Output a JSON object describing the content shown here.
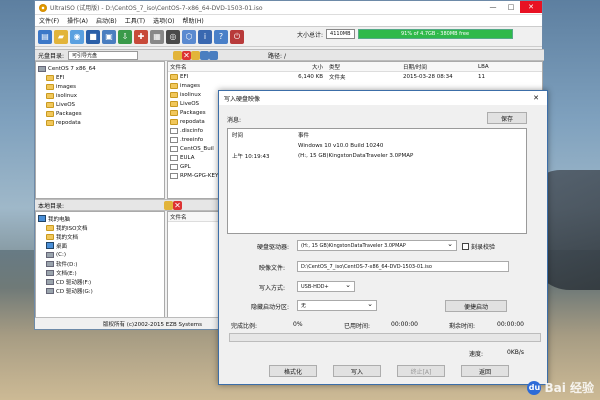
{
  "window": {
    "title": "UltraISO (试用版) - D:\\CentOS_7_iso\\CentOS-7-x86_64-DVD-1503-01.iso",
    "min": "—",
    "max": "□",
    "close": "✕"
  },
  "menu": [
    "文件(F)",
    "操作(A)",
    "启动(B)",
    "工具(T)",
    "选项(O)",
    "帮助(H)"
  ],
  "size": {
    "label": "大小总计:",
    "value": "4110MB",
    "bar": "91% of 4.7GB - 380MB free",
    "fraction": 0.91
  },
  "image_pane": {
    "label": "光盘目录:",
    "combo": "可引导光盘",
    "path_label": "路径: /"
  },
  "tree": [
    "CentOS 7 x86_64",
    "EFI",
    "images",
    "isolinux",
    "LiveOS",
    "Packages",
    "repodata"
  ],
  "files": {
    "headers": [
      "文件名",
      "大小",
      "类型",
      "日期/时间",
      "LBA"
    ],
    "rows": [
      {
        "name": "EFI",
        "size": "6,140 KB",
        "type": "文件夹",
        "date": "2015-03-28 08:34",
        "lba": "11"
      },
      {
        "name": "images",
        "size": "",
        "type": "",
        "date": "",
        "lba": ""
      },
      {
        "name": "isolinux",
        "size": "",
        "type": "",
        "date": "",
        "lba": ""
      },
      {
        "name": "LiveOS",
        "size": "",
        "type": "",
        "date": "",
        "lba": ""
      },
      {
        "name": "Packages",
        "size": "",
        "type": "",
        "date": "",
        "lba": ""
      },
      {
        "name": "repodata",
        "size": "",
        "type": "",
        "date": "",
        "lba": ""
      },
      {
        "name": ".discinfo",
        "size": "",
        "type": "",
        "date": "",
        "lba": ""
      },
      {
        "name": ".treeinfo",
        "size": "",
        "type": "",
        "date": "",
        "lba": ""
      },
      {
        "name": "CentOS_Buil",
        "size": "",
        "type": "",
        "date": "",
        "lba": ""
      },
      {
        "name": "EULA",
        "size": "",
        "type": "",
        "date": "",
        "lba": ""
      },
      {
        "name": "GPL",
        "size": "",
        "type": "",
        "date": "",
        "lba": ""
      },
      {
        "name": "RPM-GPG-KEY",
        "size": "",
        "type": "",
        "date": "",
        "lba": ""
      }
    ]
  },
  "local_pane": {
    "label": "本地目录:"
  },
  "local_tree": [
    "我的电脑",
    "我的ISO文档",
    "我的文档",
    "桌面",
    "(C:)",
    "软件(D:)",
    "文档(E:)",
    "CD 驱动器(F:)",
    "CD 驱动器(G:)"
  ],
  "local_files": {
    "header": "文件名"
  },
  "status": "版权所有 (c)2002-2015 EZB Systems",
  "dialog": {
    "title": "写入硬盘映像",
    "close": "✕",
    "msg_label": "消息:",
    "save": "保存",
    "col_time": "时间",
    "col_event": "事件",
    "rows": [
      {
        "time": "",
        "event": "Windows 10 v10.0 Build 10240"
      },
      {
        "time": "上午 10:19:43",
        "event": "(H:, 15 GB)KingstonDataTraveler 3.0PMAP"
      }
    ],
    "drive_label": "硬盘驱动器:",
    "drive": "(H:, 15 GB)KingstonDataTraveler 3.0PMAP",
    "verify": "刻录校验",
    "image_label": "映像文件:",
    "image": "D:\\CentOS_7_iso\\CentOS-7-x86_64-DVD-1503-01.iso",
    "method_label": "写入方式:",
    "method": "USB-HDD+",
    "hidden_label": "隐藏启动分区:",
    "hidden": "无",
    "boot_btn": "便捷启动",
    "done_label": "完成比例:",
    "done": "0%",
    "elapsed_label": "已用时间:",
    "elapsed": "00:00:00",
    "remain_label": "剩余时间:",
    "remain": "00:00:00",
    "speed_label": "速度:",
    "speed": "0KB/s",
    "btn_format": "格式化",
    "btn_write": "写入",
    "btn_stop": "终止[A]",
    "btn_back": "返回"
  },
  "watermark": "Bai 经验",
  "watermark_icon": "du"
}
